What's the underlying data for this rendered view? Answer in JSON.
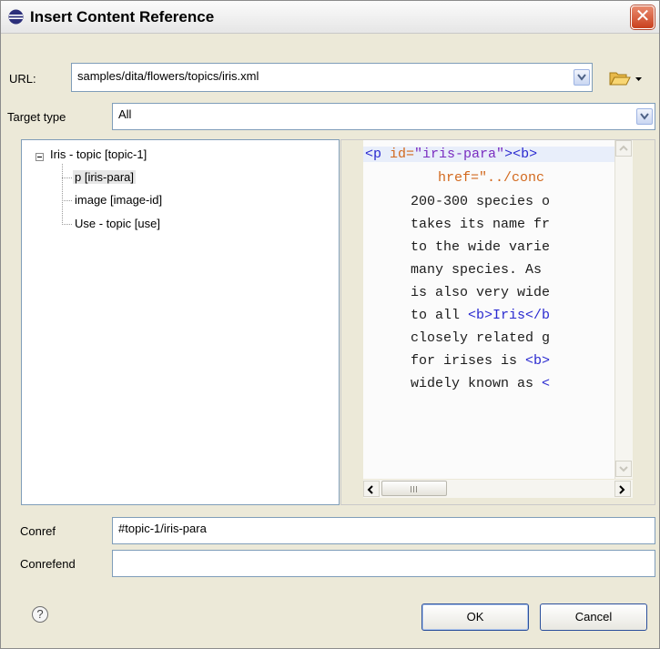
{
  "dialog": {
    "title": "Insert Content Reference",
    "close_label": "✕"
  },
  "url": {
    "label": "URL:",
    "value": "samples/dita/flowers/topics/iris.xml"
  },
  "target_type": {
    "label": "Target type",
    "value": "All"
  },
  "tree": {
    "root": "Iris - topic [topic-1]",
    "children": [
      "p [iris-para]",
      "image [image-id]",
      "Use - topic [use]"
    ],
    "selected_index": 0
  },
  "code": {
    "line0_tag_open": "<p ",
    "line0_attr": "id=",
    "line0_val": "\"iris-para\"",
    "line0_tag_close": "><b>",
    "line1_attr": "href=",
    "line1_val": "\"../conc",
    "lines": [
      "200-300 species o",
      "takes its name fr",
      "to the wide varie",
      "many species. As ",
      "is also very wide"
    ],
    "line7_text": "to all ",
    "line7_tag": "<b>Iris</b",
    "line8_text": "closely related g",
    "line9_text": "for irises is ",
    "line9_tag": "<b>",
    "line10_text": "widely known as ",
    "line10_tag": "<"
  },
  "conref": {
    "label": "Conref",
    "value": "#topic-1/iris-para"
  },
  "conrefend": {
    "label": "Conrefend",
    "value": ""
  },
  "buttons": {
    "help": "?",
    "ok": "OK",
    "cancel": "Cancel"
  },
  "icons": {
    "title": "eclipse-icon",
    "browse": "folder-open-icon",
    "help": "help-icon"
  }
}
